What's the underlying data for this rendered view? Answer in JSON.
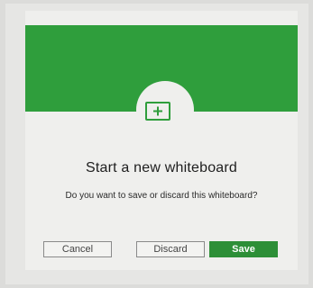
{
  "dialog": {
    "title": "Start a new whiteboard",
    "message": "Do you want to save or discard this whiteboard?",
    "icon": "whiteboard-add-icon",
    "accent_color": "#2f9e3c"
  },
  "actions": {
    "cancel_label": "Cancel",
    "discard_label": "Discard",
    "save_label": "Save",
    "save_color": "#2d8f37"
  }
}
